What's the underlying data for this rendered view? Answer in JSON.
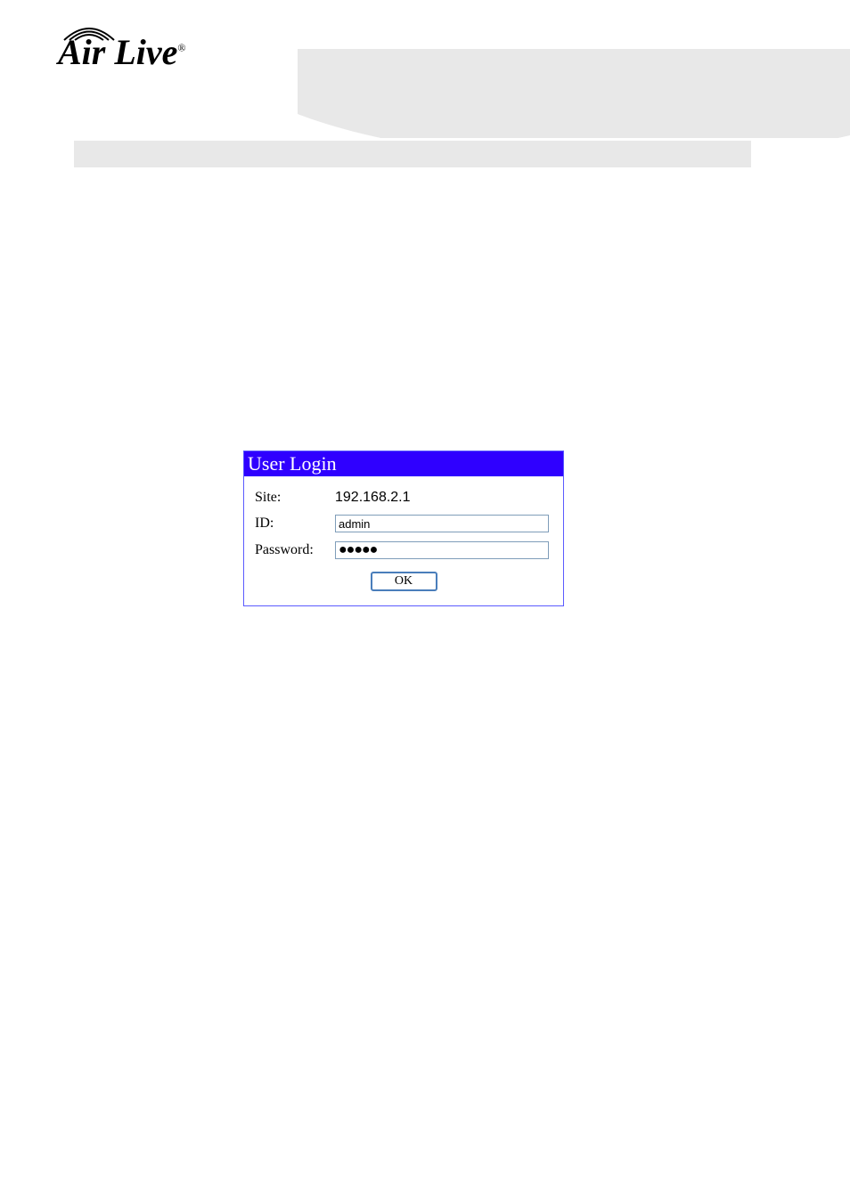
{
  "brand": {
    "name": "Air Live",
    "registered": "®"
  },
  "login": {
    "title": "User Login",
    "site_label": "Site:",
    "site_value": "192.168.2.1",
    "id_label": "ID:",
    "id_value": "admin",
    "password_label": "Password:",
    "password_value": "●●●●●",
    "ok_label": "OK"
  }
}
